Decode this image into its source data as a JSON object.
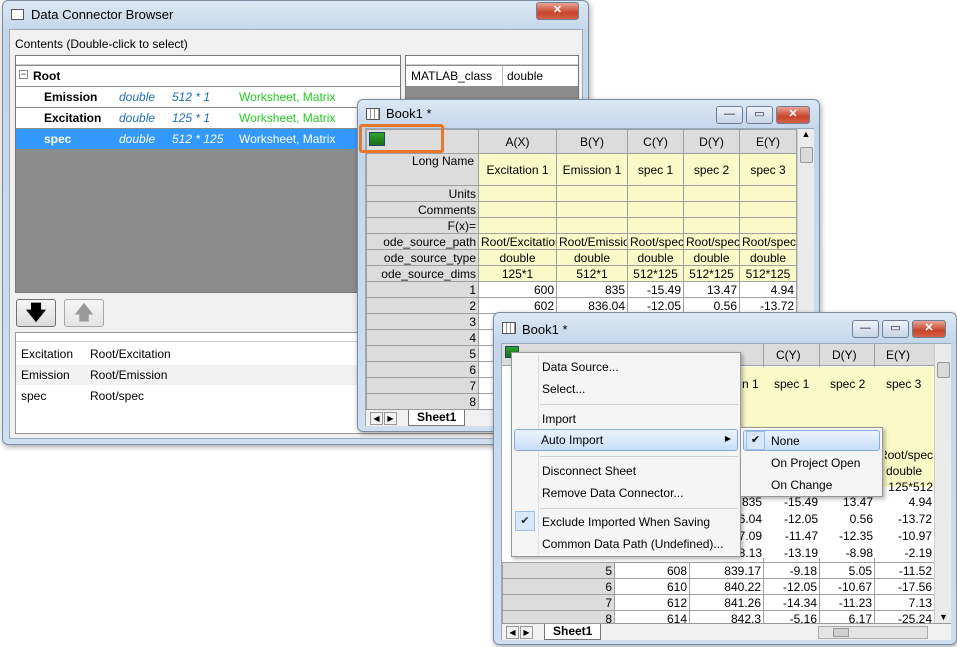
{
  "browser": {
    "title": "Data Connector Browser",
    "contents_label": "Contents (Double-click to select)",
    "tree": [
      {
        "name": "Root",
        "type": "",
        "dims": "",
        "kind": ""
      },
      {
        "name": "Emission",
        "type": "double",
        "dims": "512 * 1",
        "kind": "Worksheet, Matrix"
      },
      {
        "name": "Excitation",
        "type": "double",
        "dims": "125 * 1",
        "kind": "Worksheet, Matrix"
      },
      {
        "name": "spec",
        "type": "double",
        "dims": "512 * 125",
        "kind": "Worksheet, Matrix"
      }
    ],
    "props": {
      "key": "MATLAB_class",
      "value": "double"
    },
    "down_arrow": "🡇",
    "up_arrow": "🡅",
    "selected": [
      {
        "name": "Excitation",
        "path": "Root/Excitation"
      },
      {
        "name": "Emission",
        "path": "Root/Emission"
      },
      {
        "name": "spec",
        "path": "Root/spec"
      }
    ]
  },
  "book1": {
    "title": "Book1 *",
    "cols": [
      "A(X)",
      "B(Y)",
      "C(Y)",
      "D(Y)",
      "E(Y)"
    ],
    "row_labels": [
      "Long Name",
      "Units",
      "Comments",
      "F(x)=",
      "ode_source_path",
      "ode_source_type",
      "ode_source_dims"
    ],
    "long_names": [
      "Excitation 1",
      "Emission 1",
      "spec 1",
      "spec 2",
      "spec 3"
    ],
    "source_path": [
      "Root/Excitation",
      "Root/Emission",
      "Root/spec",
      "Root/spec",
      "Root/spec"
    ],
    "source_type": [
      "double",
      "double",
      "double",
      "double",
      "double"
    ],
    "source_dims": [
      "125*1",
      "512*1",
      "512*125",
      "512*125",
      "512*125"
    ],
    "rows": [
      {
        "n": "1",
        "v": [
          "600",
          "835",
          "-15.49",
          "13.47",
          "4.94"
        ]
      },
      {
        "n": "2",
        "v": [
          "602",
          "836.04",
          "-12.05",
          "0.56",
          "-13.72"
        ]
      },
      {
        "n": "3",
        "v": [
          "",
          "",
          "",
          "",
          ""
        ]
      },
      {
        "n": "4",
        "v": [
          "",
          "",
          "",
          "",
          ""
        ]
      },
      {
        "n": "5",
        "v": [
          "",
          "",
          "",
          "",
          ""
        ]
      },
      {
        "n": "6",
        "v": [
          "",
          "",
          "",
          "",
          ""
        ]
      },
      {
        "n": "7",
        "v": [
          "",
          "",
          "",
          "",
          ""
        ]
      },
      {
        "n": "8",
        "v": [
          "",
          "",
          "",
          "",
          ""
        ]
      }
    ],
    "sheet_tab": "Sheet1"
  },
  "book2": {
    "title": "Book1 *",
    "cols": [
      "A(X)",
      "B(Y)",
      "C(Y)",
      "D(Y)",
      "E(Y)"
    ],
    "long_frag": [
      "",
      "n 1",
      "spec 1",
      "spec 2",
      "spec 3"
    ],
    "frag_path": "Root/spec",
    "frag_type": "double",
    "frag_dims": "512*125",
    "data_frag": [
      {
        "b": "835",
        "c": "-15.49",
        "d": "13.47",
        "e": "4.94"
      },
      {
        "b": "6.04",
        "c": "-12.05",
        "d": "0.56",
        "e": "-13.72"
      },
      {
        "b": "7.09",
        "c": "-11.47",
        "d": "-12.35",
        "e": "-10.97"
      },
      {
        "b": "8.13",
        "c": "-13.19",
        "d": "-8.98",
        "e": "-2.19"
      }
    ],
    "rows": [
      {
        "n": "5",
        "v": [
          "608",
          "839.17",
          "-9.18",
          "5.05",
          "-11.52"
        ]
      },
      {
        "n": "6",
        "v": [
          "610",
          "840.22",
          "-12.05",
          "-10.67",
          "-17.56"
        ]
      },
      {
        "n": "7",
        "v": [
          "612",
          "841.26",
          "-14.34",
          "-11.23",
          "7.13"
        ]
      },
      {
        "n": "8",
        "v": [
          "614",
          "842.3",
          "-5.16",
          "6.17",
          "-25.24"
        ]
      }
    ],
    "sheet_tab": "Sheet1"
  },
  "context_menu": {
    "items": [
      "Data Source...",
      "Select...",
      "Import",
      "Auto Import",
      "Disconnect Sheet",
      "Remove Data Connector...",
      "Exclude Imported When Saving",
      "Common Data Path (Undefined)..."
    ]
  },
  "submenu": {
    "items": [
      "None",
      "On Project Open",
      "On Change"
    ]
  },
  "colors": {
    "accent": "#3399ff",
    "highlight": "#e8772a",
    "green_text": "#22cc22",
    "blue_text": "#1f6fb8"
  }
}
